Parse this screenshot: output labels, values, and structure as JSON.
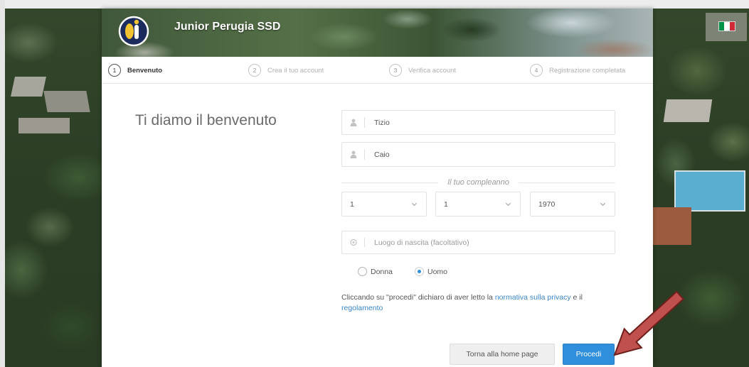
{
  "header": {
    "brand": "Junior Perugia SSD",
    "logo_icon": "club-logo-icon",
    "language_icon": "italian-flag-icon"
  },
  "steps": [
    {
      "number": "1",
      "label": "Benvenuto",
      "active": true
    },
    {
      "number": "2",
      "label": "Crea il tuo account",
      "active": false
    },
    {
      "number": "3",
      "label": "Verifica account",
      "active": false
    },
    {
      "number": "4",
      "label": "Registrazione completata",
      "active": false
    }
  ],
  "form": {
    "heading": "Ti diamo il benvenuto",
    "first_name": {
      "value": "Tizio",
      "icon": "user-icon"
    },
    "last_name": {
      "value": "Caio",
      "icon": "user-icon"
    },
    "birthday": {
      "label": "Il tuo compleanno",
      "day": "1",
      "month": "1",
      "year": "1970"
    },
    "birthplace": {
      "placeholder": "Luogo di nascita (facoltativo)",
      "icon": "location-icon"
    },
    "gender": [
      {
        "label": "Donna",
        "checked": false
      },
      {
        "label": "Uomo",
        "checked": true
      }
    ],
    "consent": {
      "text_before": "Cliccando su \"procedi\" dichiaro di aver letto la ",
      "privacy_link": "normativa sulla privacy",
      "text_middle": " e il ",
      "rules_link": "regolamento"
    }
  },
  "actions": {
    "back_label": "Torna alla home page",
    "submit_label": "Procedi"
  },
  "colors": {
    "accent": "#2f8fdc",
    "link": "#3a87c8",
    "arrow_fill": "#c0504d",
    "arrow_stroke": "#6e1f1c",
    "brand_navy": "#1c2b5e",
    "brand_yellow": "#f2c230"
  }
}
